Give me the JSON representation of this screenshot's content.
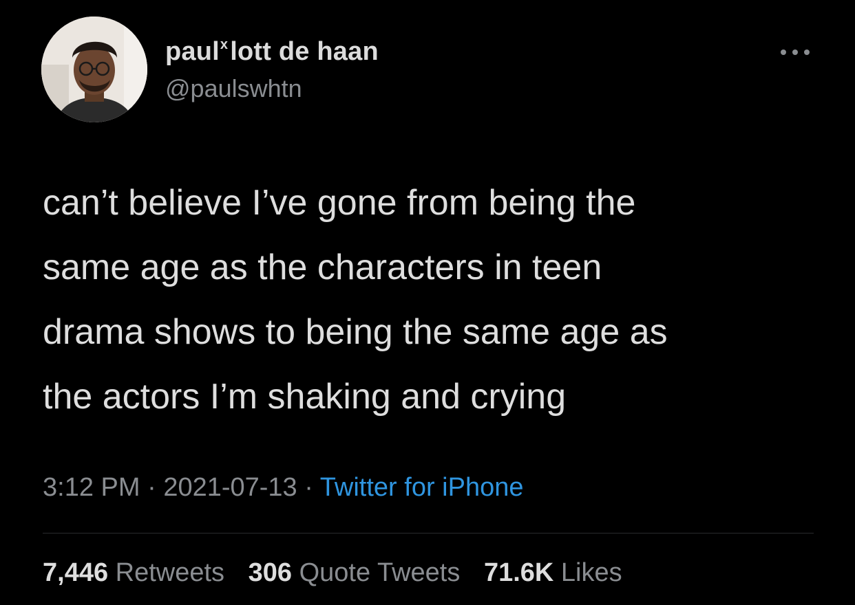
{
  "user": {
    "display_name": "paul",
    "display_name_superscript": "x",
    "display_name_rest": "lott de haan",
    "handle": "@paulswhtn",
    "avatar_icon": "profile-photo"
  },
  "tweet": {
    "lines": [
      "can’t believe I’ve gone from being the",
      "same age as the characters in teen",
      "drama shows to being the same age as",
      "the actors I’m shaking and crying"
    ]
  },
  "meta": {
    "time": "3:12 PM",
    "separator": "·",
    "date": "2021-07-13",
    "source": "Twitter for iPhone"
  },
  "stats": {
    "retweets_count": "7,446",
    "retweets_label": "Retweets",
    "quotes_count": "306",
    "quotes_label": "Quote Tweets",
    "likes_count": "71.6K",
    "likes_label": "Likes"
  },
  "colors": {
    "background": "#000000",
    "text": "#dedede",
    "muted": "#8a8d91",
    "accent": "#2f95e0"
  },
  "icons": {
    "more": "more-horizontal-icon"
  }
}
